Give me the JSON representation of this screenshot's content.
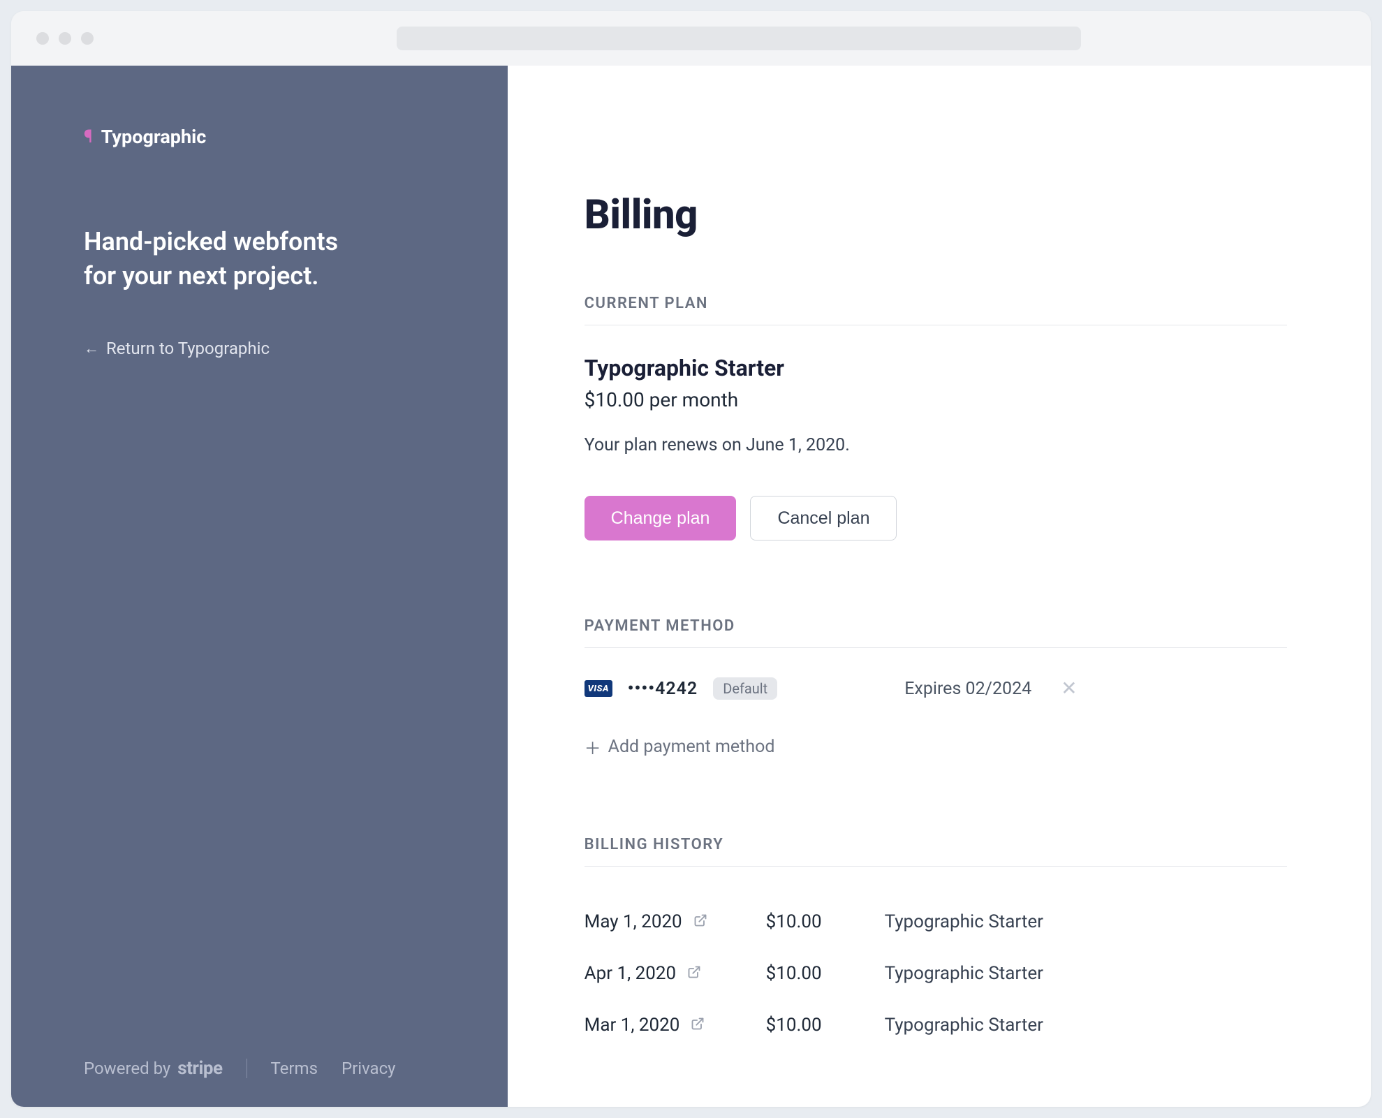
{
  "sidebar": {
    "brand_name": "Typographic",
    "tagline": "Hand-picked webfonts for your next project.",
    "return_label": "Return to Typographic",
    "footer": {
      "powered_by_prefix": "Powered by",
      "powered_by_brand": "stripe",
      "terms_label": "Terms",
      "privacy_label": "Privacy"
    }
  },
  "main": {
    "title": "Billing",
    "sections": {
      "current_plan_label": "CURRENT PLAN",
      "payment_method_label": "PAYMENT METHOD",
      "billing_history_label": "BILLING HISTORY"
    },
    "plan": {
      "name": "Typographic Starter",
      "price": "$10.00 per month",
      "renew_text": "Your plan renews on June 1, 2020.",
      "change_plan_label": "Change plan",
      "cancel_plan_label": "Cancel plan"
    },
    "payment_method": {
      "card_brand": "VISA",
      "card_last4": "••••4242",
      "default_badge": "Default",
      "expires_label": "Expires 02/2024",
      "add_label": "Add payment method"
    },
    "history": [
      {
        "date": "May 1, 2020",
        "amount": "$10.00",
        "desc": "Typographic Starter"
      },
      {
        "date": "Apr 1, 2020",
        "amount": "$10.00",
        "desc": "Typographic Starter"
      },
      {
        "date": "Mar 1, 2020",
        "amount": "$10.00",
        "desc": "Typographic Starter"
      }
    ]
  },
  "colors": {
    "sidebar_bg": "#5d6883",
    "accent_pink": "#d977cf",
    "brand_glyph": "#d76bc0"
  }
}
